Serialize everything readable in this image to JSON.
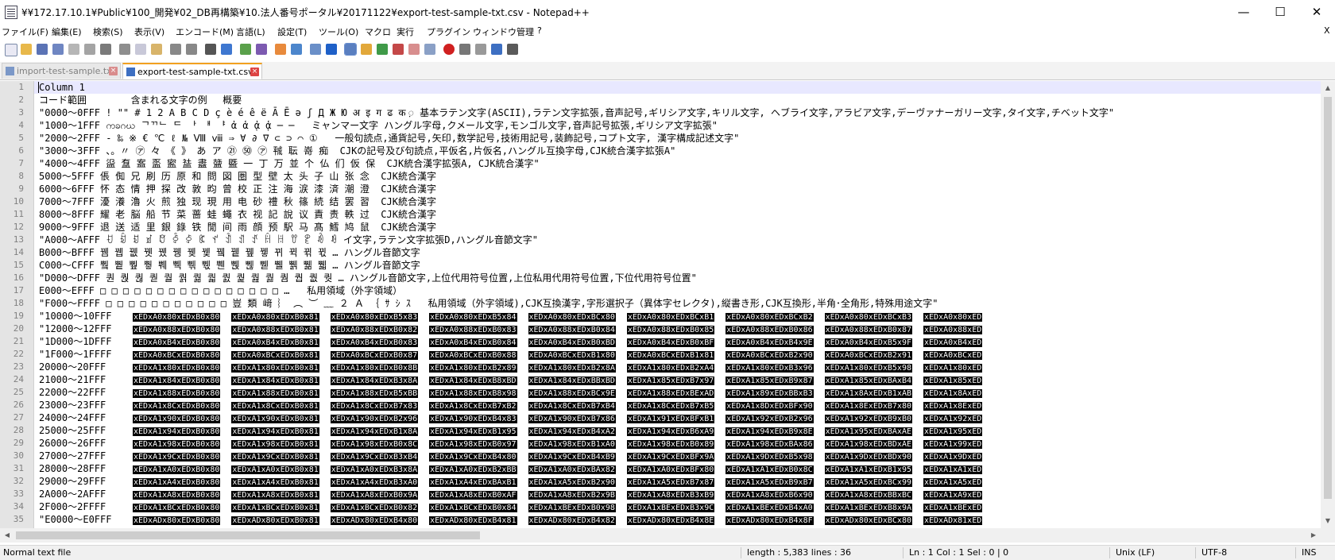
{
  "window": {
    "title": "¥¥172.17.10.1¥Public¥100_開発¥02_DB再構築¥10.法人番号ポータル¥20171122¥export-test-sample-txt.csv - Notepad++",
    "minimize": "—",
    "maximize": "☐",
    "close": "✕"
  },
  "menu": {
    "items": [
      "ファイル(F)",
      "編集(E)",
      "検索(S)",
      "表示(V)",
      "エンコード(M)",
      "言語(L)",
      "設定(T)",
      "ツール(O)",
      "マクロ",
      "実行",
      "プラグイン",
      "ウィンドウ管理",
      "?"
    ],
    "close_doc": "X"
  },
  "tabs": [
    {
      "label": "import-test-sample.txt",
      "active": false
    },
    {
      "label": "export-test-sample-txt.csv",
      "active": true
    }
  ],
  "lines": [
    {
      "num": "1",
      "text": "Column 1"
    },
    {
      "num": "2",
      "text": "コード範囲\t含まれる文字の例\t概要"
    },
    {
      "num": "3",
      "text": "\"0000～0FFF ! \"\" # 1 2 A B C D ç è é ê ë Ā Ē ə ʃ Д Ж Ю अ इ ग ढ क ़ 基本ラテン文字(ASCII),ラテン文字拡張,音声記号,ギリシア文字,キリル文字, ヘブライ文字,アラビア文字,デーヴァナーガリー文字,タイ文字,チベット文字\""
    },
    {
      "num": "4",
      "text": "\"1000～1FFF ကခဂဃ ᄀᄁᄂ ᄃ ᅡ ᅢ ᅣ ἀ ἁ ᾀ ᾁ ─ ─   ミャンマー文字 ハングル字母,クメール文字,モンゴル文字,音声記号拡張,ギリシア文字拡張\""
    },
    {
      "num": "5",
      "text": "\"2000～2FFF - ‰ ※ € ℃ ℓ № Ⅷ ⅷ ⇒ ∀ ∂ ∇ ⊂ ⊃ ⌒ ①   一般句読点,通貨記号,矢印,数学記号,技術用記号,装飾記号,コプト文字, 漢字構成記述文字\""
    },
    {
      "num": "6",
      "text": "\"3000～3FFF 、。〃 ㋐ 々 《 》 あ ア ㉑ ㊿ ㋐ ㍻ 耺 嵜 痴  CJKの記号及び句読点,平仮名,片仮名,ハングル互換字母,CJK統合漢字拡張A\""
    },
    {
      "num": "7",
      "text": "\"4000～4FFF 䀀 䀁 䀂 䀃 䀄 䀅 䀆 䀇 䀈 一 丁 万 並 个 仏 们 仮 保  CJK統合漢字拡張A, CJK統合漢字\""
    },
    {
      "num": "8",
      "text": "5000～5FFF 倀 倁 兄 刷 历 原 和 問 図 圏 型 壁 太 头 子 山 张 念  CJK統合漢字"
    },
    {
      "num": "9",
      "text": "6000～6FFF 怀 态 情 押 探 改 敦 昀 曾 校 正 注 海 涙 漆 済 潮 澄  CJK統合漢字"
    },
    {
      "num": "10",
      "text": "7000～7FFF 瀀 瀁 瀂 火 煎 独 现 現 用 电 砂 禮 秋 篠 続 结 罢 習  CJK統合漢字"
    },
    {
      "num": "11",
      "text": "8000～8FFF 耀 老 脳 船 节 菜 蔷 蛙 蠅 衣 视 記 說 议 責 责 軼 过  CJK統合漢字"
    },
    {
      "num": "12",
      "text": "9000～9FFF 退 送 适 里 銀 錄 铁 閒 间 雨 顔 预 駅 马 髙 鱈 鸠 鼠  CJK統合漢字"
    },
    {
      "num": "13",
      "text": "\"A000～AFFF ꀀ ꀁ ꀂ ꀃ ꀄ ꀅ ꀆ ꀇ ꀈ ꀉ ꀊ ꀋ ꀌ ꀍ ꀎ ꀏ ꀐ ꀑ イ文字,ラテン文字拡張D,ハングル音節文字\""
    },
    {
      "num": "14",
      "text": "B000～BFFF 뀀 뀁 뀂 뀃 뀄 뀅 뀆 뀇 뀈 뀉 뀊 뀋 뀌 뀍 뀎 뀏 … ハングル音節文字"
    },
    {
      "num": "15",
      "text": "C000～CFFF 쀀 쀁 쀂 쀃 쀄 쀅 쀆 쀇 쀈 쀉 쀊 쀋 쀌 쀍 쀎 쀏 … ハングル音節文字"
    },
    {
      "num": "16",
      "text": "\"D000～DFFF 퀀 퀁 퀂 퀃 퀄 퀅 퀆 퀇 퀈 퀉 퀊 퀋 퀌 퀍 퀎 퀏 … ハングル音節文字,上位代用符号位置,上位私用代用符号位置,下位代用符号位置\""
    },
    {
      "num": "17",
      "text": "E000～EFFF □ □ □ □ □ □ □ □ □ □ □ □ □ □ □ □ …   私用領域（外字領域）"
    },
    {
      "num": "18",
      "text": "\"F000～FFFF □ □ □ □ □ □ □ □ □ □ □ 豈 類 﨑 ︴ ︵ ︶ ﹏ ２ Ａ ｛ ｻ ｼ ｽ   私用領域（外字領域),CJK互換漢字,字形選択子（異体字セレクタ),縦書き形,CJK互換形,半角･全角形,特殊用途文字\""
    }
  ],
  "byte_lines": [
    {
      "num": "19",
      "label": "\"10000～10FFF",
      "cells": [
        "xEDxA0x80xEDxB0x80",
        "xEDxA0x80xEDxB0x81",
        "xEDxA0x80xEDxB5x83",
        "xEDxA0x80xEDxB5x84",
        "xEDxA0x80xEDxBCx80",
        "xEDxA0x80xEDxBCxB1",
        "xEDxA0x80xEDxBCxB2",
        "xEDxA0x80xEDxBCxB3",
        "xEDxA0x80xED"
      ]
    },
    {
      "num": "20",
      "label": "\"12000～12FFF",
      "cells": [
        "xEDxA0x88xEDxB0x80",
        "xEDxA0x88xEDxB0x81",
        "xEDxA0x88xEDxB0x82",
        "xEDxA0x88xEDxB0x83",
        "xEDxA0x88xEDxB0x84",
        "xEDxA0x88xEDxB0x85",
        "xEDxA0x88xEDxB0x86",
        "xEDxA0x88xEDxB0x87",
        "xEDxA0x88xED"
      ]
    },
    {
      "num": "21",
      "label": "\"1D000～1DFFF",
      "cells": [
        "xEDxA0xB4xEDxB0x80",
        "xEDxA0xB4xEDxB0x81",
        "xEDxA0xB4xEDxB0x83",
        "xEDxA0xB4xEDxB0x84",
        "xEDxA0xB4xEDxB0xBD",
        "xEDxA0xB4xEDxB0xBF",
        "xEDxA0xB4xEDxB4x9E",
        "xEDxA0xB4xEDxB5x9F",
        "xEDxA0xB4xED"
      ]
    },
    {
      "num": "22",
      "label": "\"1F000～1FFFF",
      "cells": [
        "xEDxA0xBCxEDxB0x80",
        "xEDxA0xBCxEDxB0x81",
        "xEDxA0xBCxEDxB0x87",
        "xEDxA0xBCxEDxB0x88",
        "xEDxA0xBCxEDxB1x80",
        "xEDxA0xBCxEDxB1x81",
        "xEDxA0xBCxEDxB2x90",
        "xEDxA0xBCxEDxB2x91",
        "xEDxA0xBCxED"
      ]
    },
    {
      "num": "23",
      "label": "20000～20FFF",
      "cells": [
        "xEDxA1x80xEDxB0x80",
        "xEDxA1x80xEDxB0x81",
        "xEDxA1x80xEDxB0x8B",
        "xEDxA1x80xEDxB2x89",
        "xEDxA1x80xEDxB2x8A",
        "xEDxA1x80xEDxB2xA4",
        "xEDxA1x80xEDxB3x96",
        "xEDxA1x80xEDxB5x98",
        "xEDxA1x80xED"
      ]
    },
    {
      "num": "24",
      "label": "21000～21FFF",
      "cells": [
        "xEDxA1x84xEDxB0x80",
        "xEDxA1x84xEDxB0x81",
        "xEDxA1x84xEDxB3x8A",
        "xEDxA1x84xEDxB8xBD",
        "xEDxA1x84xEDxBBxBD",
        "xEDxA1x85xEDxB7x97",
        "xEDxA1x85xEDxB9x87",
        "xEDxA1x85xEDxBAxB4",
        "xEDxA1x85xED"
      ]
    },
    {
      "num": "25",
      "label": "22000～22FFF",
      "cells": [
        "xEDxA1x88xEDxB0x80",
        "xEDxA1x88xEDxB0x81",
        "xEDxA1x88xEDxB5xBB",
        "xEDxA1x88xEDxB8x98",
        "xEDxA1x88xEDxBCx9E",
        "xEDxA1x88xEDxBExAD",
        "xEDxA1x89xEDxBBxB3",
        "xEDxA1x8AxEDxB1xAB",
        "xEDxA1x8AxED"
      ]
    },
    {
      "num": "26",
      "label": "23000～23FFF",
      "cells": [
        "xEDxA1x8CxEDxB0x80",
        "xEDxA1x8CxEDxB0x81",
        "xEDxA1x8CxEDxB7x83",
        "xEDxA1x8CxEDxB7xB2",
        "xEDxA1x8CxEDxB7xB4",
        "xEDxA1x8CxEDxB7xB5",
        "xEDxA1x8DxEDxBFx90",
        "xEDxA1x8ExEDxB7x80",
        "xEDxA1x8ExED"
      ]
    },
    {
      "num": "27",
      "label": "24000～24FFF",
      "cells": [
        "xEDxA1x90xEDxB0x80",
        "xEDxA1x90xEDxB0x81",
        "xEDxA1x90xEDxB2x96",
        "xEDxA1x90xEDxB4x83",
        "xEDxA1x90xEDxB7x86",
        "xEDxA1x91xEDxBFxB1",
        "xEDxA1x92xEDxB2x96",
        "xEDxA1x92xEDxB9xB0",
        "xEDxA1x92xED"
      ]
    },
    {
      "num": "28",
      "label": "25000～25FFF",
      "cells": [
        "xEDxA1x94xEDxB0x80",
        "xEDxA1x94xEDxB0x81",
        "xEDxA1x94xEDxB1x8A",
        "xEDxA1x94xEDxB1x95",
        "xEDxA1x94xEDxB4xA2",
        "xEDxA1x94xEDxB6xA9",
        "xEDxA1x94xEDxB9x8E",
        "xEDxA1x95xEDxBAxAE",
        "xEDxA1x95xED"
      ]
    },
    {
      "num": "29",
      "label": "26000～26FFF",
      "cells": [
        "xEDxA1x98xEDxB0x80",
        "xEDxA1x98xEDxB0x81",
        "xEDxA1x98xEDxB0x8C",
        "xEDxA1x98xEDxB0x97",
        "xEDxA1x98xEDxB1xA0",
        "xEDxA1x98xEDxB0x89",
        "xEDxA1x98xEDxBAx86",
        "xEDxA1x98xEDxBDxAE",
        "xEDxA1x99xED"
      ]
    },
    {
      "num": "30",
      "label": "27000～27FFF",
      "cells": [
        "xEDxA1x9CxEDxB0x80",
        "xEDxA1x9CxEDxB0x81",
        "xEDxA1x9CxEDxB3xB4",
        "xEDxA1x9CxEDxB4x80",
        "xEDxA1x9CxEDxB4xB9",
        "xEDxA1x9CxEDxBFx9A",
        "xEDxA1x9DxEDxB5x98",
        "xEDxA1x9DxEDxBDx90",
        "xEDxA1x9DxED"
      ]
    },
    {
      "num": "31",
      "label": "28000～28FFF",
      "cells": [
        "xEDxA1xA0xEDxB0x80",
        "xEDxA1xA0xEDxB0x81",
        "xEDxA1xA0xEDxB3x8A",
        "xEDxA1xA0xEDxB2xBB",
        "xEDxA1xA0xEDxBAx82",
        "xEDxA1xA0xEDxBFx80",
        "xEDxA1xA1xEDxB0x8C",
        "xEDxA1xA1xEDxB1x95",
        "xEDxA1xA1xED"
      ]
    },
    {
      "num": "32",
      "label": "29000～29FFF",
      "cells": [
        "xEDxA1xA4xEDxB0x80",
        "xEDxA1xA4xEDxB0x81",
        "xEDxA1xA4xEDxB3xA0",
        "xEDxA1xA4xEDxBAxB1",
        "xEDxA1xA5xEDxB2x90",
        "xEDxA1xA5xEDxB7x87",
        "xEDxA1xA5xEDxB9xB7",
        "xEDxA1xA5xEDxBCx99",
        "xEDxA1xA5xED"
      ]
    },
    {
      "num": "33",
      "label": "2A000～2AFFF",
      "cells": [
        "xEDxA1xA8xEDxB0x80",
        "xEDxA1xA8xEDxB0x81",
        "xEDxA1xA8xEDxB0x9A",
        "xEDxA1xA8xEDxB0xAF",
        "xEDxA1xA8xEDxB2x9B",
        "xEDxA1xA8xEDxB3xB9",
        "xEDxA1xA8xEDxB6x90",
        "xEDxA1xA8xEDxBBxBC",
        "xEDxA1xA9xED"
      ]
    },
    {
      "num": "34",
      "label": "2F000～2FFFF",
      "cells": [
        "xEDxA1xBCxEDxB0x80",
        "xEDxA1xBCxEDxB0x81",
        "xEDxA1xBCxEDxB0x82",
        "xEDxA1xBCxEDxB0x84",
        "xEDxA1xBExEDxB0x98",
        "xEDxA1xBExEDxB3x9C",
        "xEDxA1xBExEDxB4xA0",
        "xEDxA1xBExEDxB8x9A",
        "xEDxA1xBExED"
      ]
    },
    {
      "num": "35",
      "label": "\"E0000～E0FFF",
      "cells": [
        "xEDxADx80xEDxB0x80",
        "xEDxADx80xEDxB0x81",
        "xEDxADx80xEDxB4x80",
        "xEDxADx80xEDxB4x81",
        "xEDxADx80xEDxB4x82",
        "xEDxADx80xEDxB4x8E",
        "xEDxADx80xEDxB4x8F",
        "xEDxADx80xEDxBCx80",
        "xEDxADx81xED"
      ]
    }
  ],
  "status": {
    "file_type": "Normal text file",
    "length": "length : 5,383   lines : 36",
    "position": "Ln : 1   Col : 1   Sel : 0 | 0",
    "eol": "Unix (LF)",
    "encoding": "UTF-8",
    "mode": "INS"
  }
}
